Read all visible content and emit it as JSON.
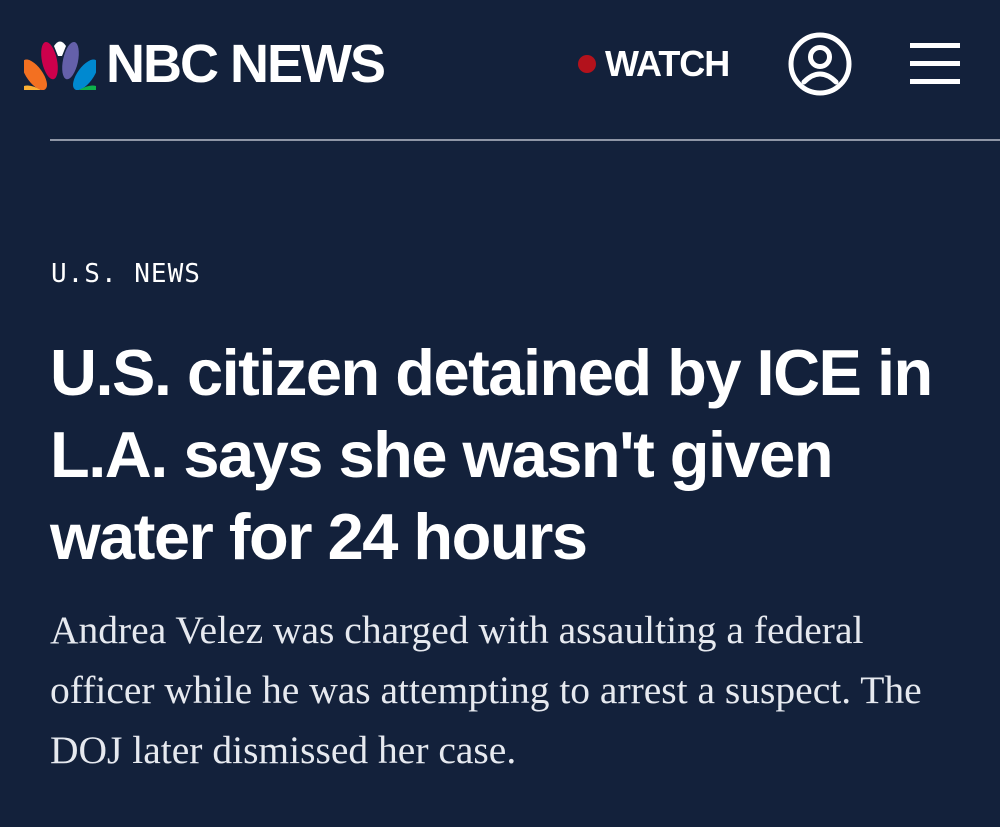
{
  "header": {
    "logo_text": "NBC NEWS",
    "logo_icon": "nbc-peacock-icon",
    "watch_label": "WATCH",
    "live_dot_color": "#b3121c",
    "account_icon": "user-account-icon",
    "menu_icon": "hamburger-menu-icon"
  },
  "article": {
    "section": "U.S. NEWS",
    "headline": "U.S. citizen detained by ICE in L.A. says she wasn't given water for 24 hours",
    "dek": "Andrea Velez was charged with assaulting a federal officer while he was attempting to arrest a suspect. The DOJ later dismissed her case."
  },
  "colors": {
    "background": "#13213b",
    "text": "#ffffff",
    "divider": "#8f96a6",
    "peacock": [
      "#fbb034",
      "#f37021",
      "#cc004c",
      "#6460aa",
      "#0089d0",
      "#0db14b"
    ]
  }
}
